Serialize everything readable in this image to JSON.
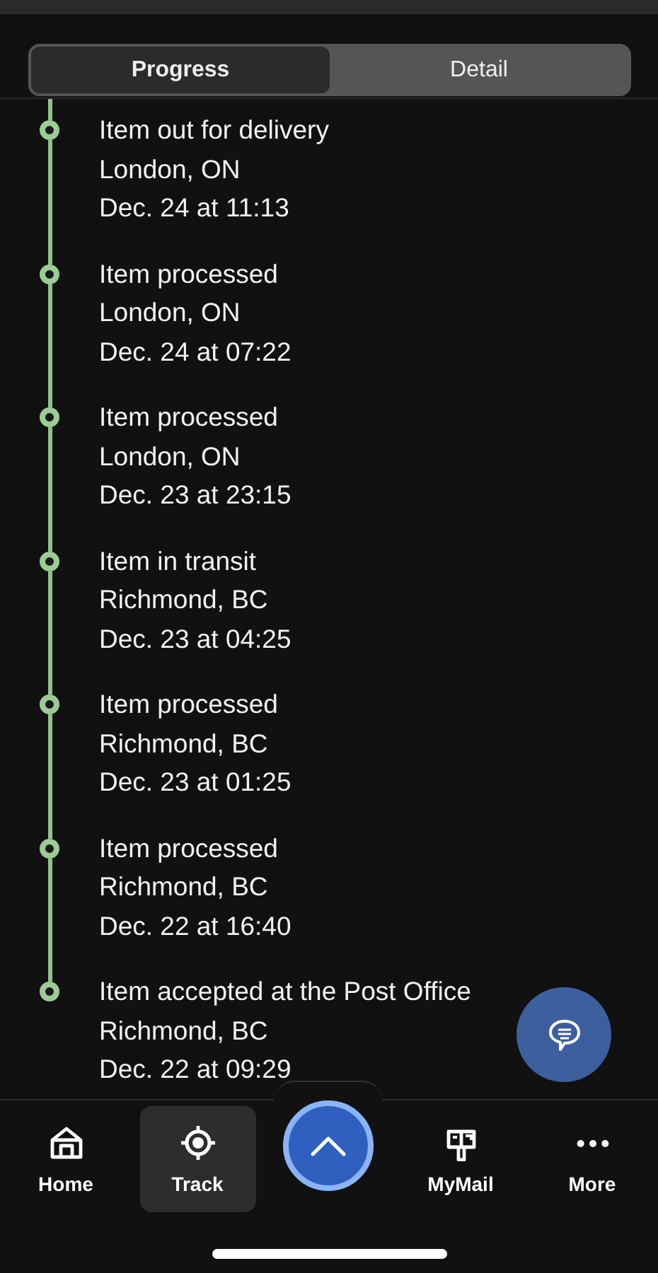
{
  "tabs": [
    {
      "label": "Progress",
      "selected": true
    },
    {
      "label": "Detail",
      "selected": false
    }
  ],
  "events": [
    {
      "status": "Item out for delivery",
      "location": "London, ON",
      "time": "Dec. 24 at 11:13"
    },
    {
      "status": "Item processed",
      "location": "London, ON",
      "time": "Dec. 24 at 07:22"
    },
    {
      "status": "Item processed",
      "location": "London, ON",
      "time": "Dec. 23 at 23:15"
    },
    {
      "status": "Item in transit",
      "location": "Richmond, BC",
      "time": "Dec. 23 at 04:25"
    },
    {
      "status": "Item processed",
      "location": "Richmond, BC",
      "time": "Dec. 23 at 01:25"
    },
    {
      "status": "Item processed",
      "location": "Richmond, BC",
      "time": "Dec. 22 at 16:40"
    },
    {
      "status": "Item accepted at the Post Office",
      "location": "Richmond, BC",
      "time": "Dec. 22 at 09:29"
    }
  ],
  "nav": [
    {
      "kind": "home",
      "label": "Home",
      "selected": false
    },
    {
      "kind": "track",
      "label": "Track",
      "selected": true
    },
    {
      "kind": "scan",
      "selected": false
    },
    {
      "kind": "mymail",
      "label": "MyMail",
      "selected": false
    },
    {
      "kind": "more",
      "label": "More",
      "selected": false
    }
  ]
}
